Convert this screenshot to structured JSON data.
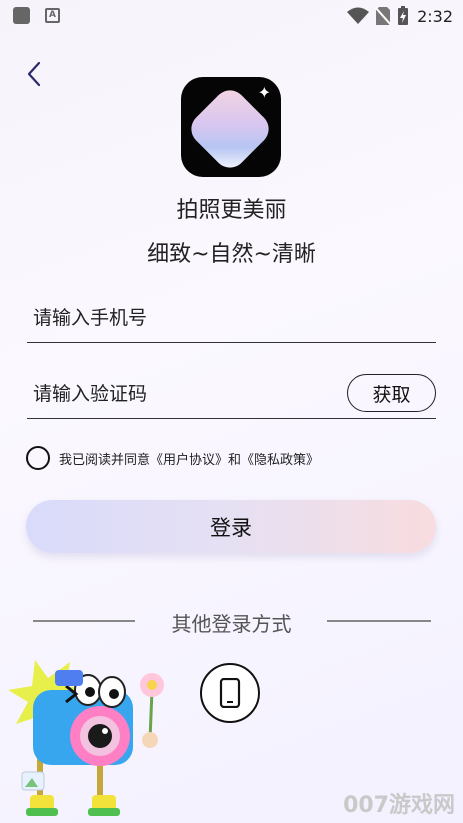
{
  "status_bar": {
    "time": "2:32",
    "notification_icon_letter": "A"
  },
  "header": {
    "back_icon": "chevron-left-icon"
  },
  "app": {
    "name": "拍照更美丽",
    "slogan": "细致~自然~清晰"
  },
  "form": {
    "phone_placeholder": "请输入手机号",
    "phone_value": "",
    "code_placeholder": "请输入验证码",
    "code_value": "",
    "get_code_label": "获取"
  },
  "agreement": {
    "checked": false,
    "text": "我已阅读并同意《用户协议》和《隐私政策》"
  },
  "login_button": {
    "label": "登录"
  },
  "other_login": {
    "title": "其他登录方式",
    "phone_icon": "mobile-phone-icon"
  },
  "watermark": {
    "text": "007游戏网"
  },
  "colors": {
    "login_gradient_start": "#d9dbfb",
    "login_gradient_end": "#f8dcdf",
    "background": "#f7f3fb"
  }
}
